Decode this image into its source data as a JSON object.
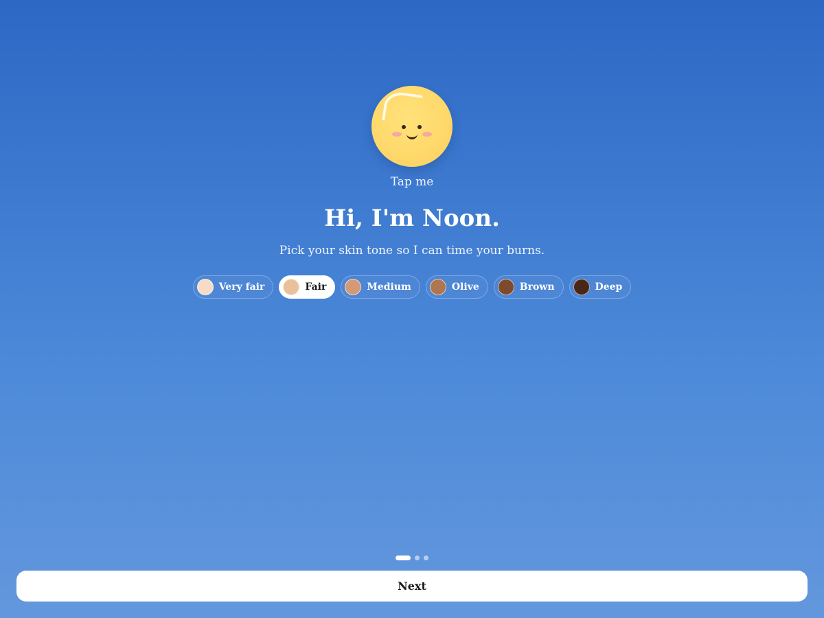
{
  "mascot": {
    "name": "sun-mascot",
    "tap_label": "Tap me"
  },
  "intro": {
    "title": "Hi, I'm Noon.",
    "subtitle": "Pick your skin tone so I can time your burns."
  },
  "skin_tones": {
    "selected": "Fair",
    "options": [
      {
        "label": "Very fair",
        "color": "#f6dcc6"
      },
      {
        "label": "Fair",
        "color": "#e8c09a"
      },
      {
        "label": "Medium",
        "color": "#d49a78"
      },
      {
        "label": "Olive",
        "color": "#b07650"
      },
      {
        "label": "Brown",
        "color": "#7d4a2d"
      },
      {
        "label": "Deep",
        "color": "#4a2616"
      }
    ]
  },
  "pagination": {
    "current": 1,
    "total": 3
  },
  "footer": {
    "next_label": "Next"
  },
  "colors": {
    "background_top": "#2d68c5",
    "background_bottom": "#6397dd",
    "sun": "#ffd86a"
  }
}
